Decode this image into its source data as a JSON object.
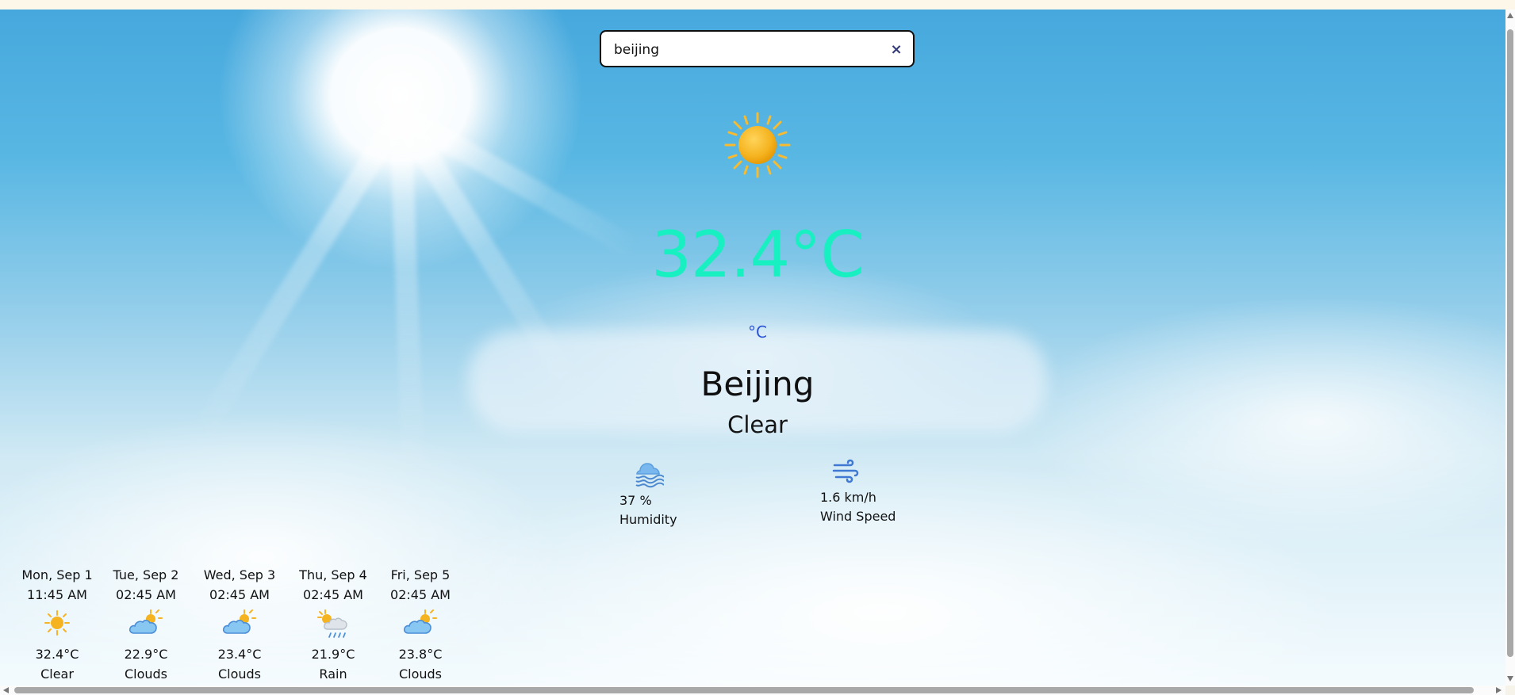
{
  "search": {
    "value": "beijing",
    "clear_label": "×"
  },
  "current": {
    "icon": "sun-icon",
    "temperature": "32.4°C",
    "unit_toggle": "°C",
    "city": "Beijing",
    "condition": "Clear"
  },
  "stats": {
    "humidity": {
      "icon": "humidity-cloud-icon",
      "value": "37 %",
      "label": "Humidity"
    },
    "wind": {
      "icon": "wind-icon",
      "value": "1.6 km/h",
      "label": "Wind Speed"
    }
  },
  "forecast": [
    {
      "date": "Mon, Sep 1",
      "time": "11:45 AM",
      "icon": "sun-icon",
      "temp": "32.4°C",
      "desc": "Clear"
    },
    {
      "date": "Tue, Sep 2",
      "time": "02:45 AM",
      "icon": "partly-cloudy-icon",
      "temp": "22.9°C",
      "desc": "Clouds"
    },
    {
      "date": "Wed, Sep 3",
      "time": "02:45 AM",
      "icon": "partly-cloudy-icon",
      "temp": "23.4°C",
      "desc": "Clouds"
    },
    {
      "date": "Thu, Sep 4",
      "time": "02:45 AM",
      "icon": "sun-rain-cloud-icon",
      "temp": "21.9°C",
      "desc": "Rain"
    },
    {
      "date": "Fri, Sep 5",
      "time": "02:45 AM",
      "icon": "partly-cloudy-icon",
      "temp": "23.8°C",
      "desc": "Clouds"
    }
  ],
  "colors": {
    "temperature": "#18f0c1",
    "unit_toggle": "#2a52d9",
    "text": "#111111",
    "sky_top": "#46a8dd",
    "sky_bottom": "#f4fbfe"
  }
}
